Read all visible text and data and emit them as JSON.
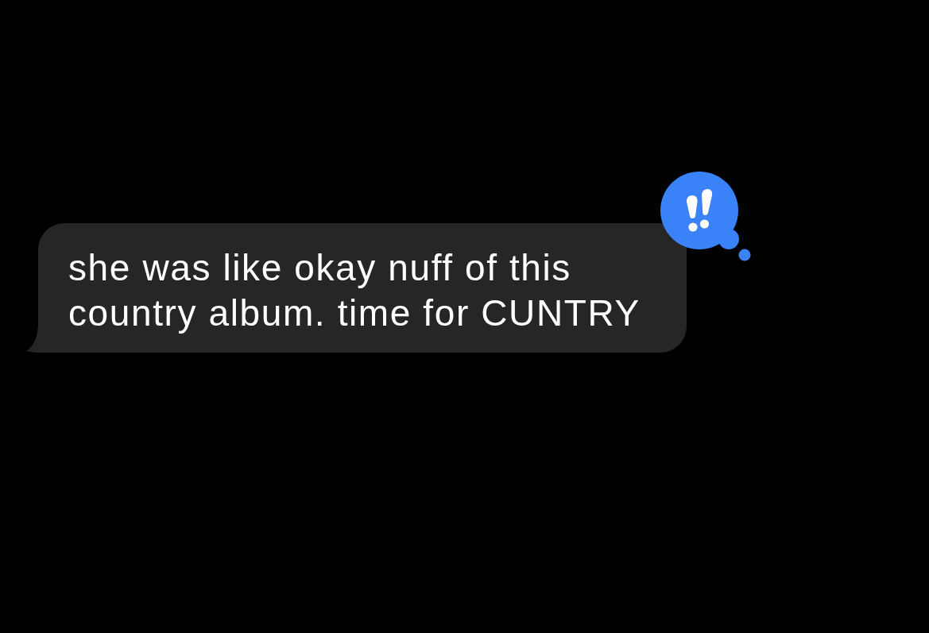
{
  "message": {
    "text": "she was like okay nuff of this\ncountry album. time for CUNTRY"
  },
  "reaction": {
    "kind": "emphasize"
  }
}
